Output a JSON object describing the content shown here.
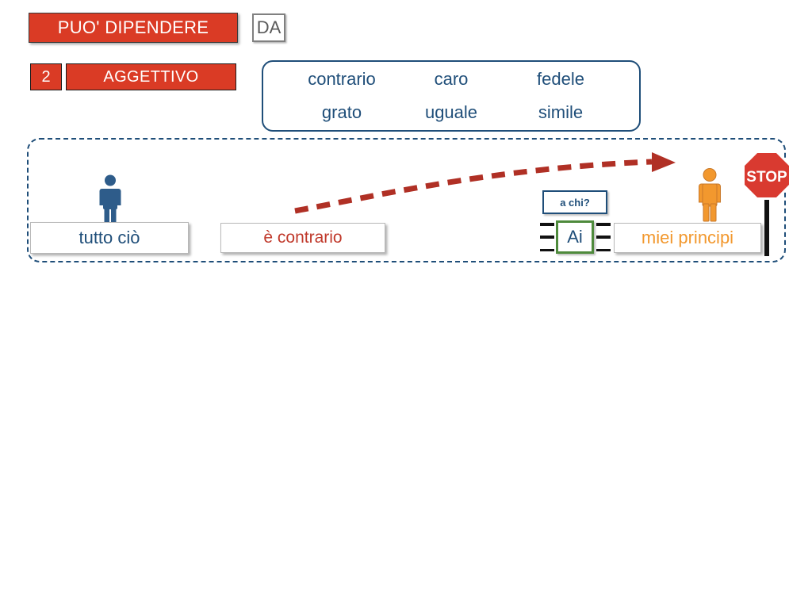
{
  "header": {
    "main_bar_label": "PUO' DIPENDERE",
    "da_box_label": "DA",
    "number_badge": "2",
    "category_label": "AGGETTIVO",
    "colors": {
      "bar_red": "#DA3B25",
      "bar_text": "#FFFFFF",
      "da_border": "#808080",
      "da_text": "#5A5A5A"
    }
  },
  "word_list": {
    "border_color": "#1F4E79",
    "text_color": "#1F4E79",
    "row1": [
      "contrario",
      "caro",
      "fedele"
    ],
    "row2": [
      "grato",
      "uguale",
      "simile"
    ]
  },
  "sentence": {
    "container_border_color": "#1F4E79",
    "subject": {
      "text": "tutto ciò",
      "text_color": "#1F4E79",
      "figure_icon": "person-pictogram-icon",
      "figure_color": "#2E5C8A"
    },
    "verb": {
      "text": "è contrario",
      "text_color": "#C0392B"
    },
    "preposition": {
      "text": "Ai",
      "text_color": "#1F4E79",
      "border_color": "#4E8A3C",
      "tick_count_per_side": 3
    },
    "question_label": {
      "text": "a chi?",
      "text_color": "#1F4E79",
      "border_color": "#1F4E79"
    },
    "object": {
      "text": "miei principi",
      "text_color": "#F2982E",
      "figure_icon": "person-pictogram-icon",
      "figure_color": "#F2982E"
    },
    "stop_sign": {
      "icon": "stop-sign-icon",
      "text": "STOP",
      "sign_color": "#D93A30",
      "text_color": "#FFFFFF",
      "pole_color": "#111111"
    },
    "arrow": {
      "icon": "dashed-curved-arrow-icon",
      "color": "#B03025",
      "style": "dashed"
    }
  }
}
